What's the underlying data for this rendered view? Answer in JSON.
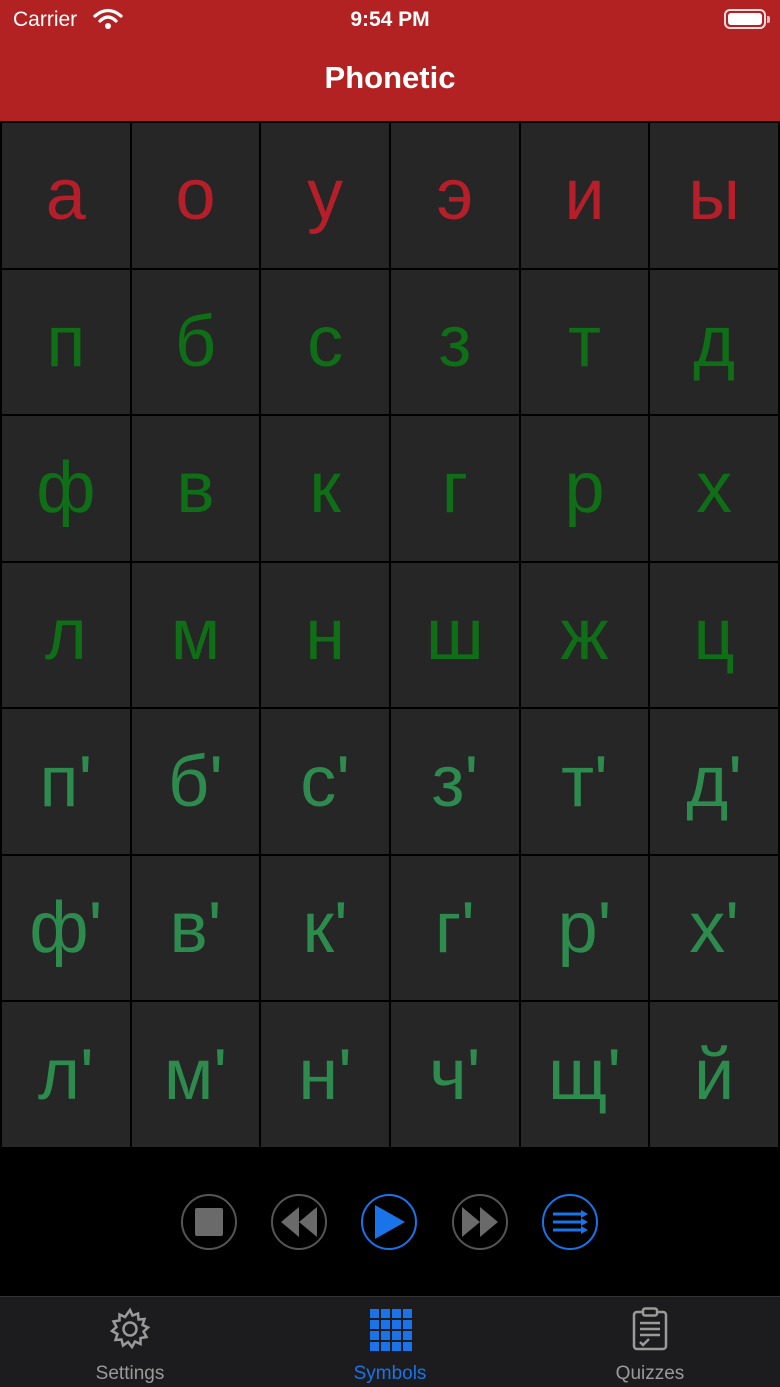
{
  "status_bar": {
    "carrier": "Carrier",
    "time": "9:54 PM"
  },
  "nav": {
    "title": "Phonetic"
  },
  "colors": {
    "header": "#b22222",
    "vowel": "#b61f2a",
    "hard_consonant": "#0f6f16",
    "soft_consonant": "#2e8b4e",
    "accent": "#1a73e8"
  },
  "symbols": [
    [
      {
        "t": "а",
        "k": "vowel"
      },
      {
        "t": "о",
        "k": "vowel"
      },
      {
        "t": "у",
        "k": "vowel"
      },
      {
        "t": "э",
        "k": "vowel"
      },
      {
        "t": "и",
        "k": "vowel"
      },
      {
        "t": "ы",
        "k": "vowel"
      }
    ],
    [
      {
        "t": "п",
        "k": "hard"
      },
      {
        "t": "б",
        "k": "hard"
      },
      {
        "t": "с",
        "k": "hard"
      },
      {
        "t": "з",
        "k": "hard"
      },
      {
        "t": "т",
        "k": "hard"
      },
      {
        "t": "д",
        "k": "hard"
      }
    ],
    [
      {
        "t": "ф",
        "k": "hard"
      },
      {
        "t": "в",
        "k": "hard"
      },
      {
        "t": "к",
        "k": "hard"
      },
      {
        "t": "г",
        "k": "hard"
      },
      {
        "t": "р",
        "k": "hard"
      },
      {
        "t": "х",
        "k": "hard"
      }
    ],
    [
      {
        "t": "л",
        "k": "hard"
      },
      {
        "t": "м",
        "k": "hard"
      },
      {
        "t": "н",
        "k": "hard"
      },
      {
        "t": "ш",
        "k": "hard"
      },
      {
        "t": "ж",
        "k": "hard"
      },
      {
        "t": "ц",
        "k": "hard"
      }
    ],
    [
      {
        "t": "п'",
        "k": "soft"
      },
      {
        "t": "б'",
        "k": "soft"
      },
      {
        "t": "с'",
        "k": "soft"
      },
      {
        "t": "з'",
        "k": "soft"
      },
      {
        "t": "т'",
        "k": "soft"
      },
      {
        "t": "д'",
        "k": "soft"
      }
    ],
    [
      {
        "t": "ф'",
        "k": "soft"
      },
      {
        "t": "в'",
        "k": "soft"
      },
      {
        "t": "к'",
        "k": "soft"
      },
      {
        "t": "г'",
        "k": "soft"
      },
      {
        "t": "р'",
        "k": "soft"
      },
      {
        "t": "х'",
        "k": "soft"
      }
    ],
    [
      {
        "t": "л'",
        "k": "soft"
      },
      {
        "t": "м'",
        "k": "soft"
      },
      {
        "t": "н'",
        "k": "soft"
      },
      {
        "t": "ч'",
        "k": "soft"
      },
      {
        "t": "щ'",
        "k": "soft"
      },
      {
        "t": "й",
        "k": "soft"
      }
    ]
  ],
  "player": {
    "buttons": [
      "stop-icon",
      "rewind-icon",
      "play-icon",
      "fast-forward-icon",
      "playlist-icon"
    ]
  },
  "tabs": [
    {
      "label": "Settings",
      "icon": "gear-icon",
      "active": false
    },
    {
      "label": "Symbols",
      "icon": "grid-icon",
      "active": true
    },
    {
      "label": "Quizzes",
      "icon": "clipboard-icon",
      "active": false
    }
  ]
}
